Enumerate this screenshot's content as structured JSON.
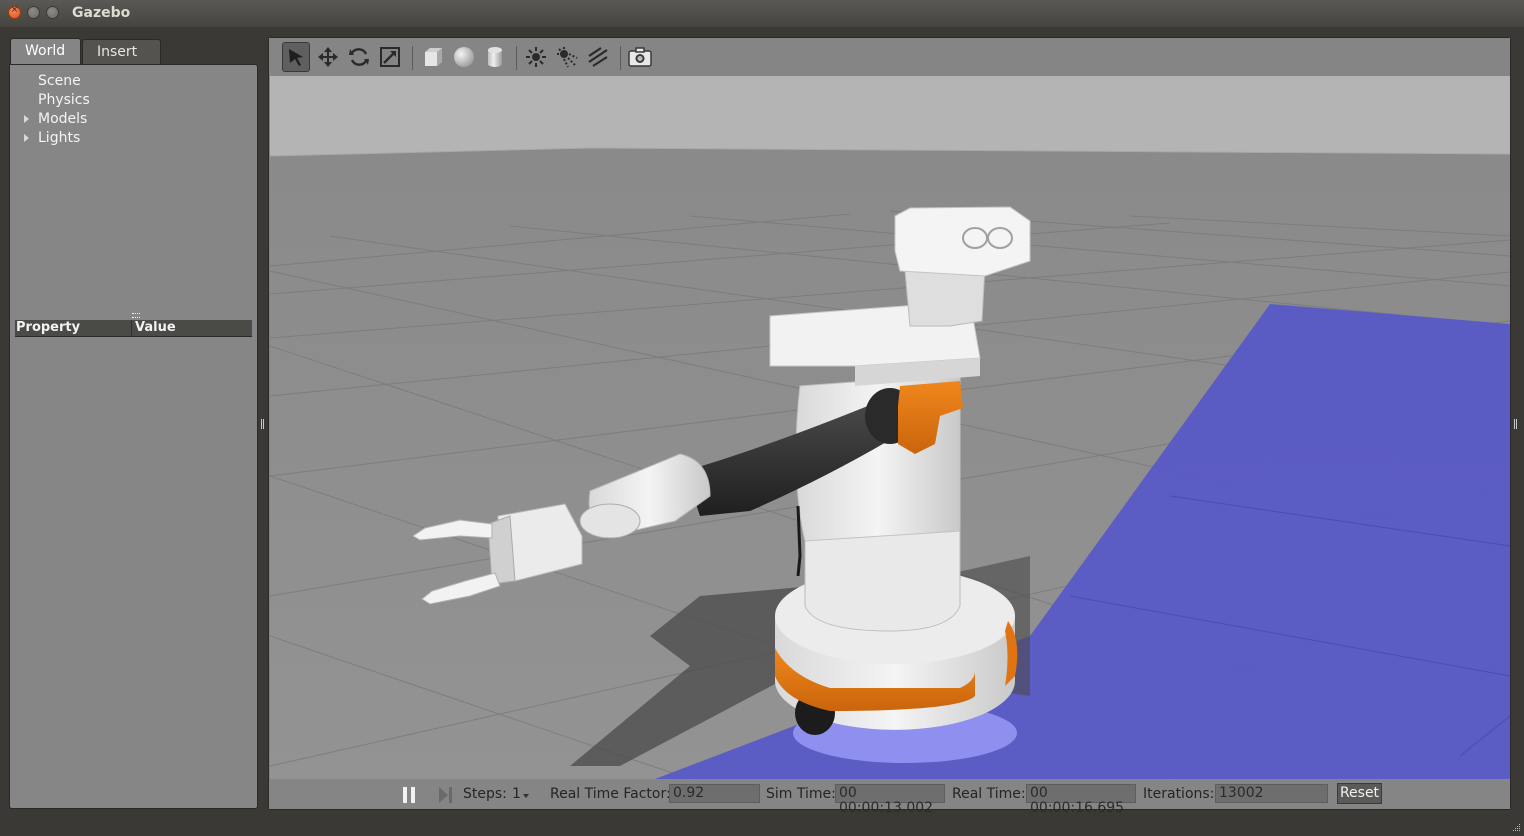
{
  "window": {
    "title": "Gazebo"
  },
  "left_panel": {
    "tabs": [
      {
        "label": "World",
        "active": true
      },
      {
        "label": "Insert",
        "active": false
      }
    ],
    "tree": [
      {
        "label": "Scene",
        "expandable": false
      },
      {
        "label": "Physics",
        "expandable": false
      },
      {
        "label": "Models",
        "expandable": true
      },
      {
        "label": "Lights",
        "expandable": true
      }
    ],
    "property_table": {
      "headers": [
        "Property",
        "Value"
      ]
    }
  },
  "toolbar": {
    "tools": [
      {
        "icon": "select-arrow-icon",
        "active": true
      },
      {
        "icon": "translate-icon"
      },
      {
        "icon": "rotate-icon"
      },
      {
        "icon": "scale-icon"
      },
      {
        "icon": "box-shape-icon"
      },
      {
        "icon": "sphere-shape-icon"
      },
      {
        "icon": "cylinder-shape-icon"
      },
      {
        "icon": "point-light-icon"
      },
      {
        "icon": "spot-light-icon"
      },
      {
        "icon": "directional-light-icon"
      },
      {
        "icon": "screenshot-camera-icon"
      }
    ]
  },
  "viewport": {
    "scene": "3D view of a mobile manipulator robot on a grey grid ground plane with a blue ground patch",
    "colors": {
      "sky": "#b3b3b3",
      "ground": "#8e8e8e",
      "blue_plane": "#5a5ac4",
      "orange": "#e87a12",
      "arm_dark": "#2e2e2e",
      "white": "#efefef"
    }
  },
  "status_bar": {
    "steps_label": "Steps:",
    "steps_value": "1",
    "real_time_factor_label": "Real Time Factor:",
    "real_time_factor_value": "0.92",
    "sim_time_label": "Sim Time:",
    "sim_time_value": "00 00:00:13.002",
    "real_time_label": "Real Time:",
    "real_time_value": "00 00:00:16.695",
    "iterations_label": "Iterations:",
    "iterations_value": "13002",
    "reset_label": "Reset"
  }
}
